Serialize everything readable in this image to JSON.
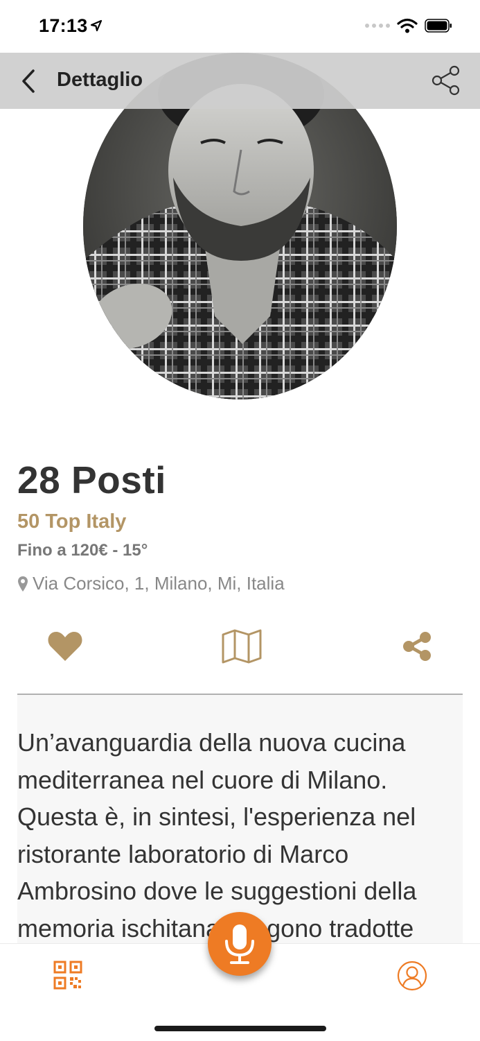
{
  "status": {
    "time": "17:13"
  },
  "nav": {
    "title": "Dettaglio"
  },
  "venue": {
    "name": "28 Posti",
    "category": "50 Top Italy",
    "price_info": "Fino a 120€ - 15°",
    "address": "Via Corsico, 1, Milano, Mi, Italia"
  },
  "description": "Un’avanguardia della nuova cucina mediterranea nel cuore di Milano. Questa è, in sintesi, l'esperienza nel ristorante laboratorio di Marco Ambrosino dove le suggestioni della memoria ischitana vengono tradotte dalla",
  "hero_image": {
    "subject": "man in plaid shirt portrait"
  },
  "icons": {
    "back": "chevron-left-icon",
    "share_nav": "share-icon",
    "favorite": "heart-icon",
    "map": "map-icon",
    "share": "share-icon",
    "qr": "qr-code-icon",
    "mic": "microphone-icon",
    "profile": "user-icon"
  },
  "colors": {
    "accent_gold": "#b39565",
    "accent_orange": "#ee7b24",
    "text_dark": "#333333"
  }
}
